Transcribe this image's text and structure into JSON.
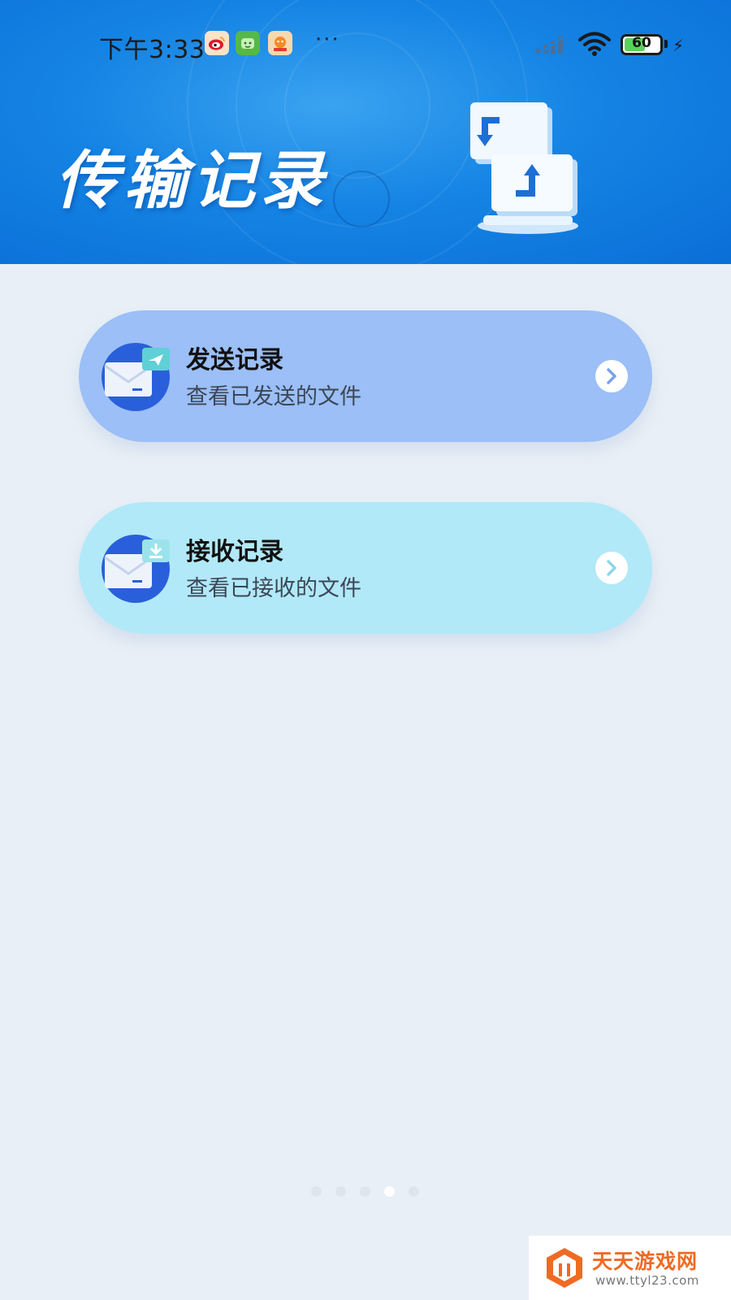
{
  "status_bar": {
    "time": "下午3:33",
    "more": "···",
    "battery_level": "60",
    "battery_fraction": 0.6,
    "app_icons": [
      "weibo-icon",
      "wechat-mini-icon",
      "game-app-icon"
    ]
  },
  "header": {
    "title": "传输记录"
  },
  "records": [
    {
      "title": "发送记录",
      "subtitle": "查看已发送的文件"
    },
    {
      "title": "接收记录",
      "subtitle": "查看已接收的文件"
    }
  ],
  "pager": {
    "count": 5,
    "active_index": 3
  },
  "watermark": {
    "title": "天天游戏网",
    "url": "www.ttyl23.com"
  },
  "colors": {
    "header_blue": "#1584e4",
    "send_card": "#9bbff6",
    "receive_card": "#b1e9f8",
    "background": "#e8eff6",
    "watermark_orange": "#f06a23"
  }
}
